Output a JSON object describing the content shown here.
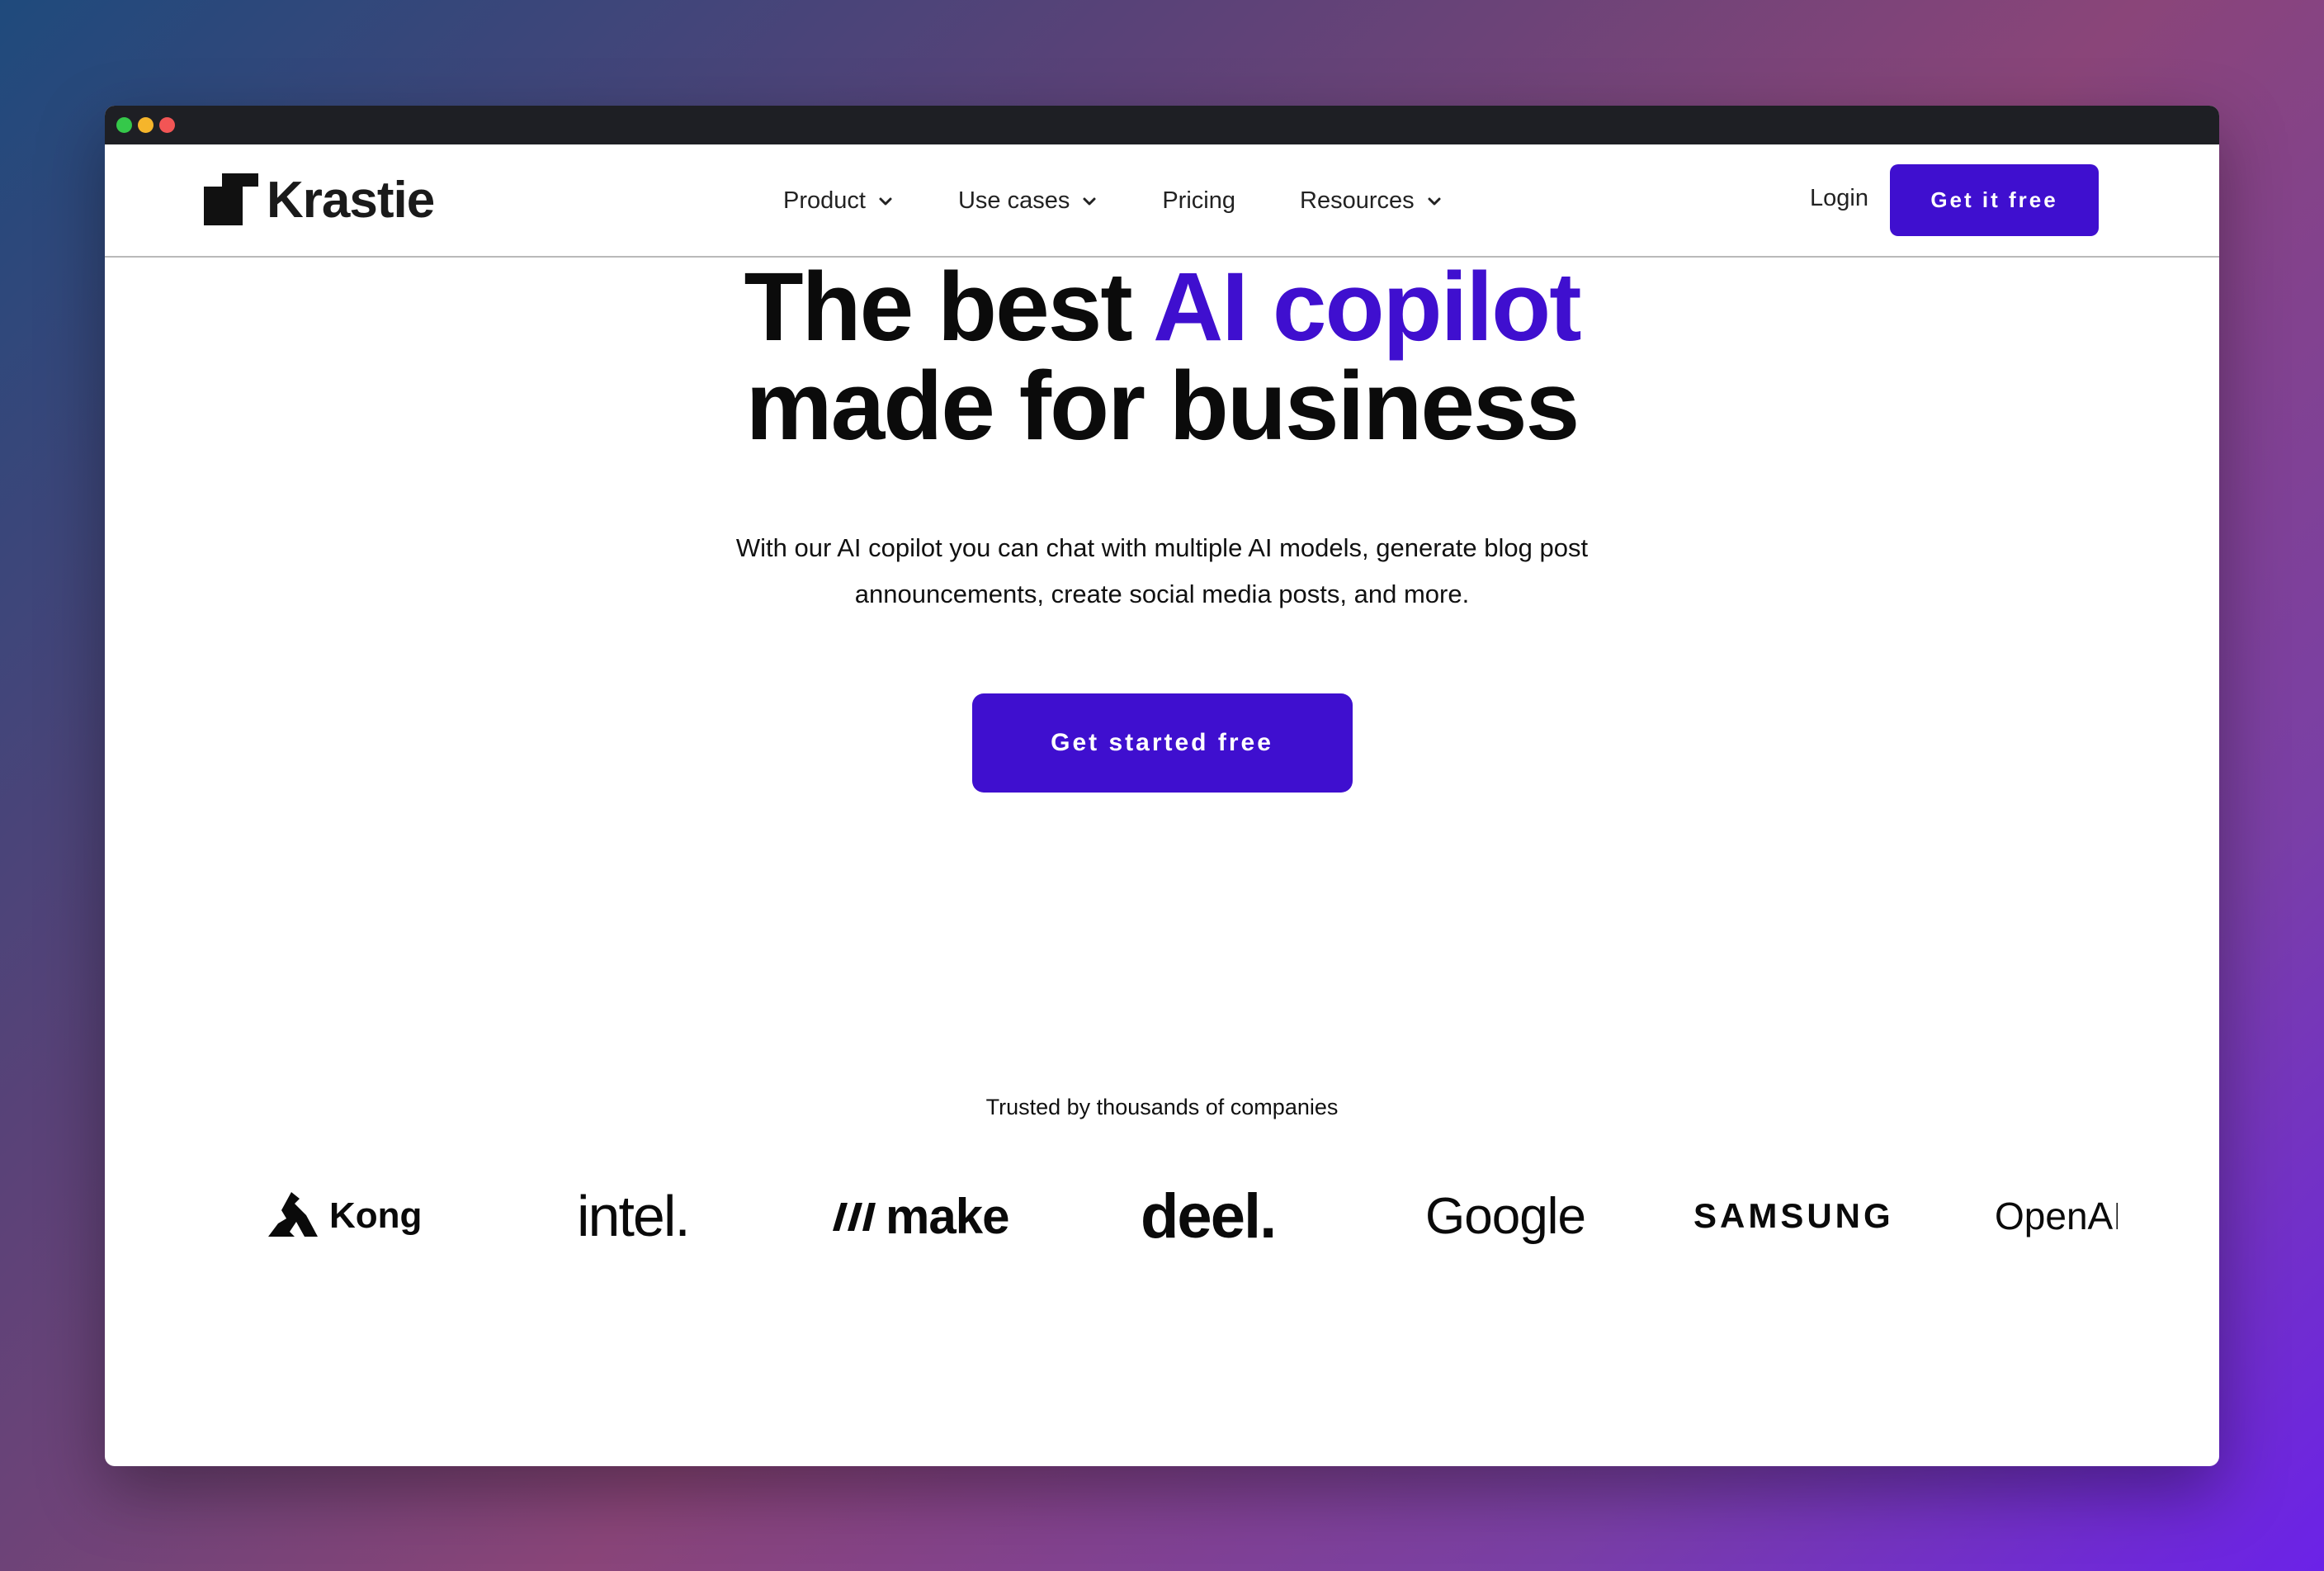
{
  "brand": {
    "name": "Krastie"
  },
  "nav": {
    "items": [
      {
        "label": "Product",
        "has_dropdown": true
      },
      {
        "label": "Use cases",
        "has_dropdown": true
      },
      {
        "label": "Pricing",
        "has_dropdown": false
      },
      {
        "label": "Resources",
        "has_dropdown": true
      }
    ],
    "login_label": "Login",
    "cta_label": "Get it free"
  },
  "hero": {
    "headline_pre": "The best ",
    "headline_accent": "AI copilot",
    "headline_line2": "made for business",
    "subtext_line1": "With our AI copilot you can chat with multiple AI models, generate blog post",
    "subtext_line2": "announcements, create social media posts, and more.",
    "cta_label": "Get started free"
  },
  "trusted": {
    "label": "Trusted by thousands of companies",
    "logos": [
      "Kong",
      "intel.",
      "make",
      "deel.",
      "Google",
      "SAMSUNG",
      "OpenAI"
    ]
  },
  "colors": {
    "accent": "#3f0fcf",
    "titlebar": "#1e1f24",
    "dot_green": "#35c84a",
    "dot_yellow": "#f5b52b",
    "dot_red": "#f25555"
  }
}
